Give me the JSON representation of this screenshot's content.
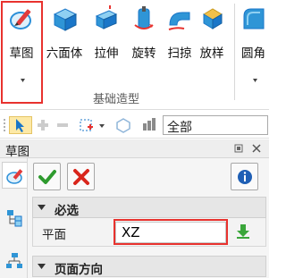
{
  "ribbon": {
    "tools": [
      {
        "label": "草图",
        "icon": "sketch-icon"
      },
      {
        "label": "六面体",
        "icon": "cube-icon"
      },
      {
        "label": "拉伸",
        "icon": "extrude-icon"
      },
      {
        "label": "旋转",
        "icon": "revolve-icon"
      },
      {
        "label": "扫掠",
        "icon": "sweep-icon"
      },
      {
        "label": "放样",
        "icon": "loft-icon"
      },
      {
        "label": "圆角",
        "icon": "fillet-icon"
      }
    ],
    "group_label": "基础造型"
  },
  "toolbar": {
    "filter_value": "全部"
  },
  "panel": {
    "title": "草图",
    "section_required": "必选",
    "plane_label": "平面",
    "plane_value": "XZ",
    "section_page_direction": "页面方向"
  },
  "colors": {
    "highlight": "#e8322e",
    "accent_blue": "#1a76c8",
    "ok_green": "#2f9b2f",
    "cancel_red": "#d9261c"
  }
}
